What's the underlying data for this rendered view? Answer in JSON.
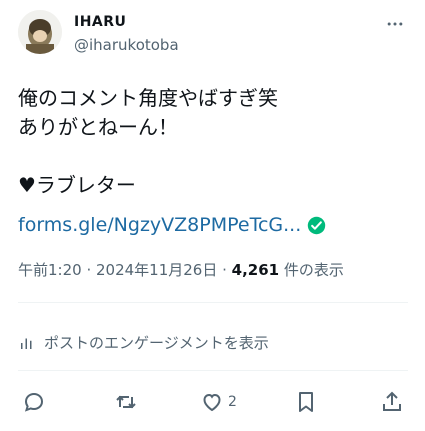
{
  "header": {
    "display_name": "IHARU",
    "handle": "@iharukotoba"
  },
  "tweet": {
    "text": "俺のコメント角度やばすぎ笑\nありがとねーん！\n\n♥ラブレター",
    "link": "forms.gle/NgzyVZ8PMPeTcG...",
    "time": "午前1:20 · 2024年11月26日 · ",
    "views_count": "4,261",
    "views_label": " 件の表示"
  },
  "engagement_link": "ポストのエンゲージメントを表示",
  "actions": {
    "reply_count": "",
    "retweet_count": "",
    "like_count": "2",
    "bookmark_count": ""
  },
  "icons": {
    "more": "more-dots-icon",
    "reply": "reply-icon",
    "retweet": "retweet-icon",
    "like": "heart-icon",
    "bookmark": "bookmark-icon",
    "share": "share-icon",
    "verified": "check-badge-icon",
    "engagement": "analytics-icon"
  },
  "colors": {
    "link": "#1d6aa2",
    "secondary": "#536471",
    "text": "#0f1419",
    "verified": "#00ba7c"
  }
}
